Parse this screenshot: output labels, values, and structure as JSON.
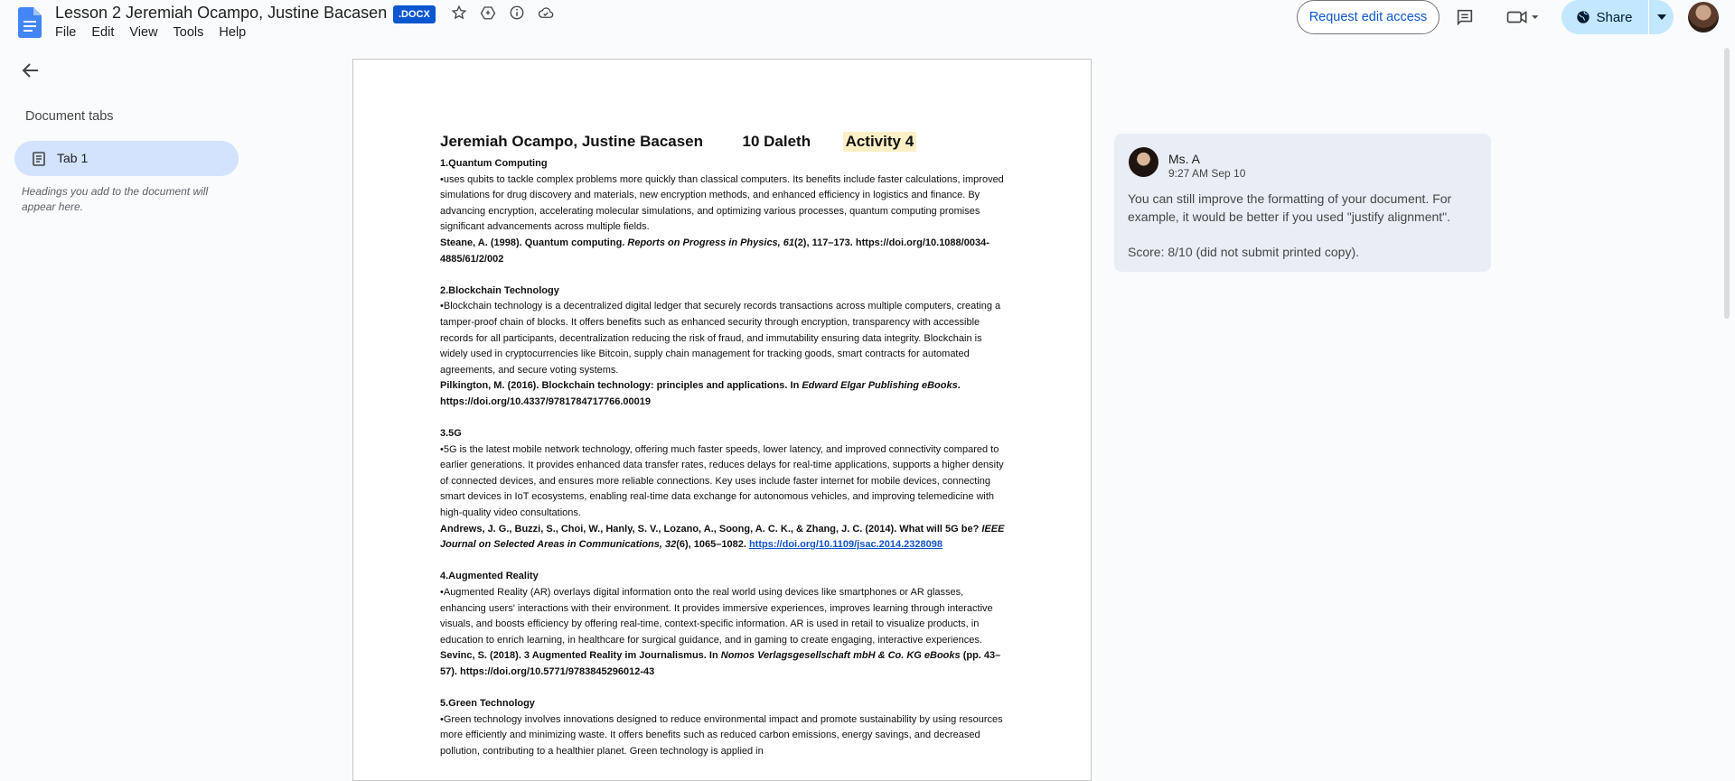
{
  "header": {
    "title": "Lesson 2 Jeremiah Ocampo, Justine Bacasen",
    "badge": ".DOCX",
    "menu": [
      "File",
      "Edit",
      "View",
      "Tools",
      "Help"
    ],
    "request_access": "Request edit access",
    "share": "Share"
  },
  "sidebar": {
    "heading": "Document tabs",
    "tab_label": "Tab 1",
    "hint": "Headings you add to the document will appear here."
  },
  "document": {
    "heading": {
      "names": "Jeremiah Ocampo, Justine Bacasen",
      "section": "10 Daleth",
      "activity": "Activity 4"
    },
    "sections": [
      {
        "title": "1.Quantum Computing",
        "body": " •uses qubits to tackle complex problems more quickly than classical computers. Its benefits include faster calculations, improved simulations for drug discovery and materials, new encryption methods, and enhanced efficiency in logistics and finance. By advancing encryption, accelerating molecular simulations, and optimizing various processes, quantum computing promises significant advancements across multiple fields.",
        "cite_a": "Steane, A. (1998). Quantum computing. ",
        "cite_i": "Reports on Progress in Physics, 61",
        "cite_b": "(2), 117–173. https://doi.org/10.1088/0034-4885/61/2/002",
        "link": ""
      },
      {
        "title": "2.Blockchain Technology",
        "body": "•Blockchain technology is a decentralized digital ledger that securely records transactions across multiple computers, creating a tamper-proof chain of blocks. It offers benefits such as enhanced security through encryption, transparency with accessible records for all participants, decentralization reducing the risk of fraud, and immutability ensuring data integrity. Blockchain is widely used in cryptocurrencies like Bitcoin, supply chain management for tracking goods, smart contracts for automated agreements, and secure voting systems.",
        "cite_a": "Pilkington, M. (2016). Blockchain technology: principles and applications. In ",
        "cite_i": "Edward Elgar Publishing eBooks",
        "cite_b": ". https://doi.org/10.4337/9781784717766.00019",
        "link": ""
      },
      {
        "title": "3.5G",
        "body": "•5G is the latest mobile network technology, offering much faster speeds, lower latency, and improved connectivity compared to earlier generations. It provides enhanced data transfer rates, reduces delays for real-time applications, supports a higher density of connected devices, and ensures more reliable connections. Key uses include faster internet for mobile devices, connecting smart devices in IoT ecosystems, enabling real-time data exchange for autonomous vehicles, and improving telemedicine with high-quality video consultations.",
        "cite_a": "Andrews, J. G., Buzzi, S., Choi, W., Hanly, S. V., Lozano, A., Soong, A. C. K., & Zhang, J. C. (2014). What will 5G be? ",
        "cite_i": "IEEE Journal on Selected Areas in Communications, 32",
        "cite_b": "(6), 1065–1082. ",
        "link": "https://doi.org/10.1109/jsac.2014.2328098"
      },
      {
        "title": "4.Augmented Reality",
        "body": "•Augmented Reality (AR) overlays digital information onto the real world using devices like smartphones or AR glasses, enhancing users' interactions with their environment. It provides immersive experiences, improves learning through interactive visuals, and boosts efficiency by offering real-time, context-specific information. AR is used in retail to visualize products, in education to enrich learning, in healthcare for surgical guidance, and in gaming to create engaging, interactive experiences.",
        "cite_a": "Sevinc, S. (2018). 3 Augmented Reality im Journalismus. In ",
        "cite_i": "Nomos Verlagsgesellschaft mbH & Co. KG eBooks",
        "cite_b": " (pp. 43–57). https://doi.org/10.5771/9783845296012-43",
        "link": ""
      },
      {
        "title": "5.Green Technology",
        "body": "•Green technology involves innovations designed to reduce environmental impact and promote sustainability by using resources more efficiently and minimizing waste. It offers benefits such as reduced carbon emissions, energy savings, and decreased pollution, contributing to a healthier planet. Green technology is applied in",
        "cite_a": "",
        "cite_i": "",
        "cite_b": "",
        "link": ""
      }
    ]
  },
  "comment": {
    "author": "Ms. A",
    "time": "9:27 AM Sep 10",
    "text": "You can still improve the formatting of your document. For example, it would be better if you used \"justify alignment\".",
    "score": "Score: 8/10 (did not submit printed copy)."
  },
  "colors": {
    "accent": "#0b57d0",
    "share_bg": "#c2e7ff",
    "tab_active_bg": "#d3e3fd",
    "comment_bg": "#e9eef6",
    "highlight": "#fdf0c6"
  },
  "icons": [
    "docs-logo-icon",
    "star-icon",
    "move-to-drive-icon",
    "info-icon",
    "cloud-status-icon",
    "comment-history-icon",
    "meet-camera-icon",
    "globe-icon",
    "chevron-down-icon",
    "back-arrow-icon",
    "document-tab-icon"
  ]
}
